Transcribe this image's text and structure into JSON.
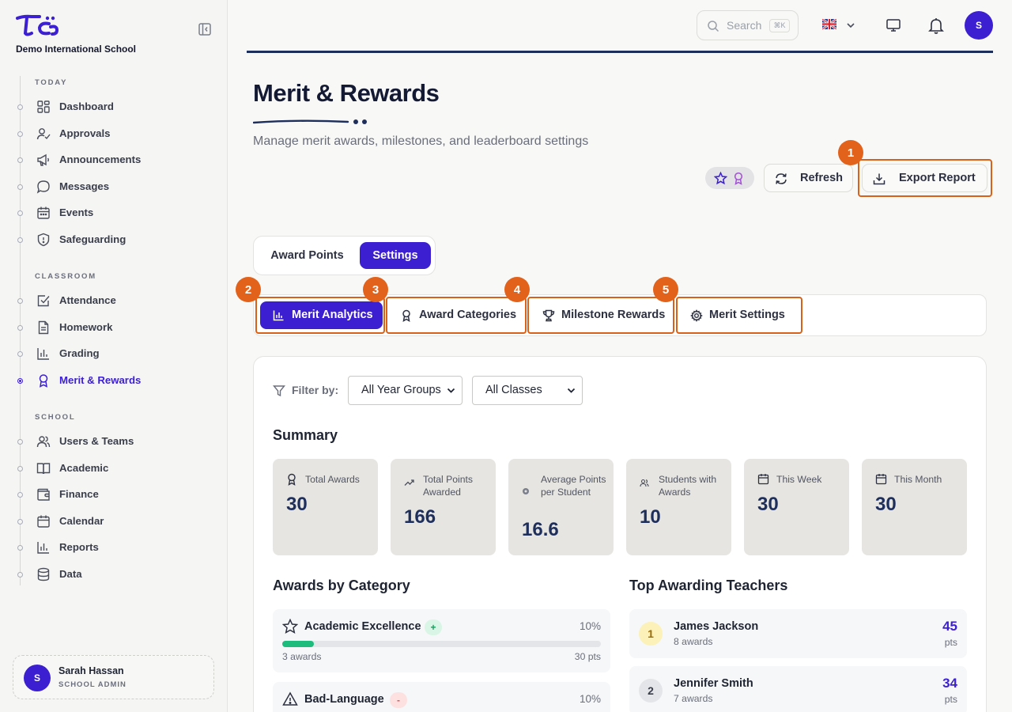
{
  "sidebar": {
    "school_name": "Demo International School",
    "sections": [
      {
        "title": "TODAY",
        "items": [
          {
            "label": "Dashboard",
            "icon": "dashboard-icon"
          },
          {
            "label": "Approvals",
            "icon": "user-check-icon"
          },
          {
            "label": "Announcements",
            "icon": "megaphone-icon"
          },
          {
            "label": "Messages",
            "icon": "message-icon"
          },
          {
            "label": "Events",
            "icon": "calendar-icon"
          },
          {
            "label": "Safeguarding",
            "icon": "shield-icon"
          }
        ]
      },
      {
        "title": "CLASSROOM",
        "items": [
          {
            "label": "Attendance",
            "icon": "checkbox-icon"
          },
          {
            "label": "Homework",
            "icon": "document-icon"
          },
          {
            "label": "Grading",
            "icon": "bar-chart-icon"
          },
          {
            "label": "Merit & Rewards",
            "icon": "award-icon",
            "active": true
          }
        ]
      },
      {
        "title": "SCHOOL",
        "items": [
          {
            "label": "Users & Teams",
            "icon": "users-icon"
          },
          {
            "label": "Academic",
            "icon": "book-icon"
          },
          {
            "label": "Finance",
            "icon": "wallet-icon"
          },
          {
            "label": "Calendar",
            "icon": "calendar-icon"
          },
          {
            "label": "Reports",
            "icon": "bar-chart-icon"
          },
          {
            "label": "Data",
            "icon": "database-icon"
          }
        ]
      }
    ],
    "user": {
      "initial": "S",
      "name": "Sarah Hassan",
      "role": "SCHOOL ADMIN"
    }
  },
  "topbar": {
    "search_placeholder": "Search",
    "search_shortcut": "⌘K",
    "avatar_initial": "S"
  },
  "header": {
    "title": "Merit & Rewards",
    "subtitle": "Manage merit awards, milestones, and leaderboard settings",
    "refresh_label": "Refresh",
    "export_label": "Export Report"
  },
  "mode_tabs": [
    {
      "label": "Award Points",
      "active": false
    },
    {
      "label": "Settings",
      "active": true
    }
  ],
  "sub_tabs": [
    {
      "label": "Merit Analytics",
      "active": true
    },
    {
      "label": "Award Categories",
      "active": false
    },
    {
      "label": "Milestone Rewards",
      "active": false
    },
    {
      "label": "Merit Settings",
      "active": false
    }
  ],
  "annotations": [
    "1",
    "2",
    "3",
    "4",
    "5"
  ],
  "filters": {
    "label": "Filter by:",
    "year_group": "All Year Groups",
    "class": "All Classes"
  },
  "summary": {
    "title": "Summary",
    "stats": [
      {
        "label": "Total Awards",
        "value": "30"
      },
      {
        "label": "Total Points Awarded",
        "value": "166"
      },
      {
        "label": "Average Points per Student",
        "value": "16.6"
      },
      {
        "label": "Students with Awards",
        "value": "10"
      },
      {
        "label": "This Week",
        "value": "30"
      },
      {
        "label": "This Month",
        "value": "30"
      }
    ]
  },
  "categories": {
    "title": "Awards by Category",
    "items": [
      {
        "name": "Academic Excellence",
        "tag": "+",
        "percent": "10%",
        "fill": 0.1,
        "awards": "3 awards",
        "points": "30 pts"
      },
      {
        "name": "Bad-Language",
        "tag": "-",
        "percent": "10%",
        "fill": 0.1
      }
    ]
  },
  "teachers": {
    "title": "Top Awarding Teachers",
    "items": [
      {
        "rank": "1",
        "name": "James Jackson",
        "awards": "8 awards",
        "points": "45",
        "unit": "pts"
      },
      {
        "rank": "2",
        "name": "Jennifer Smith",
        "awards": "7 awards",
        "points": "34",
        "unit": "pts"
      }
    ]
  },
  "colors": {
    "accent": "#3b1fd1",
    "highlight": "#d9621a",
    "success": "#1dbc7c",
    "danger": "#e2555a"
  }
}
